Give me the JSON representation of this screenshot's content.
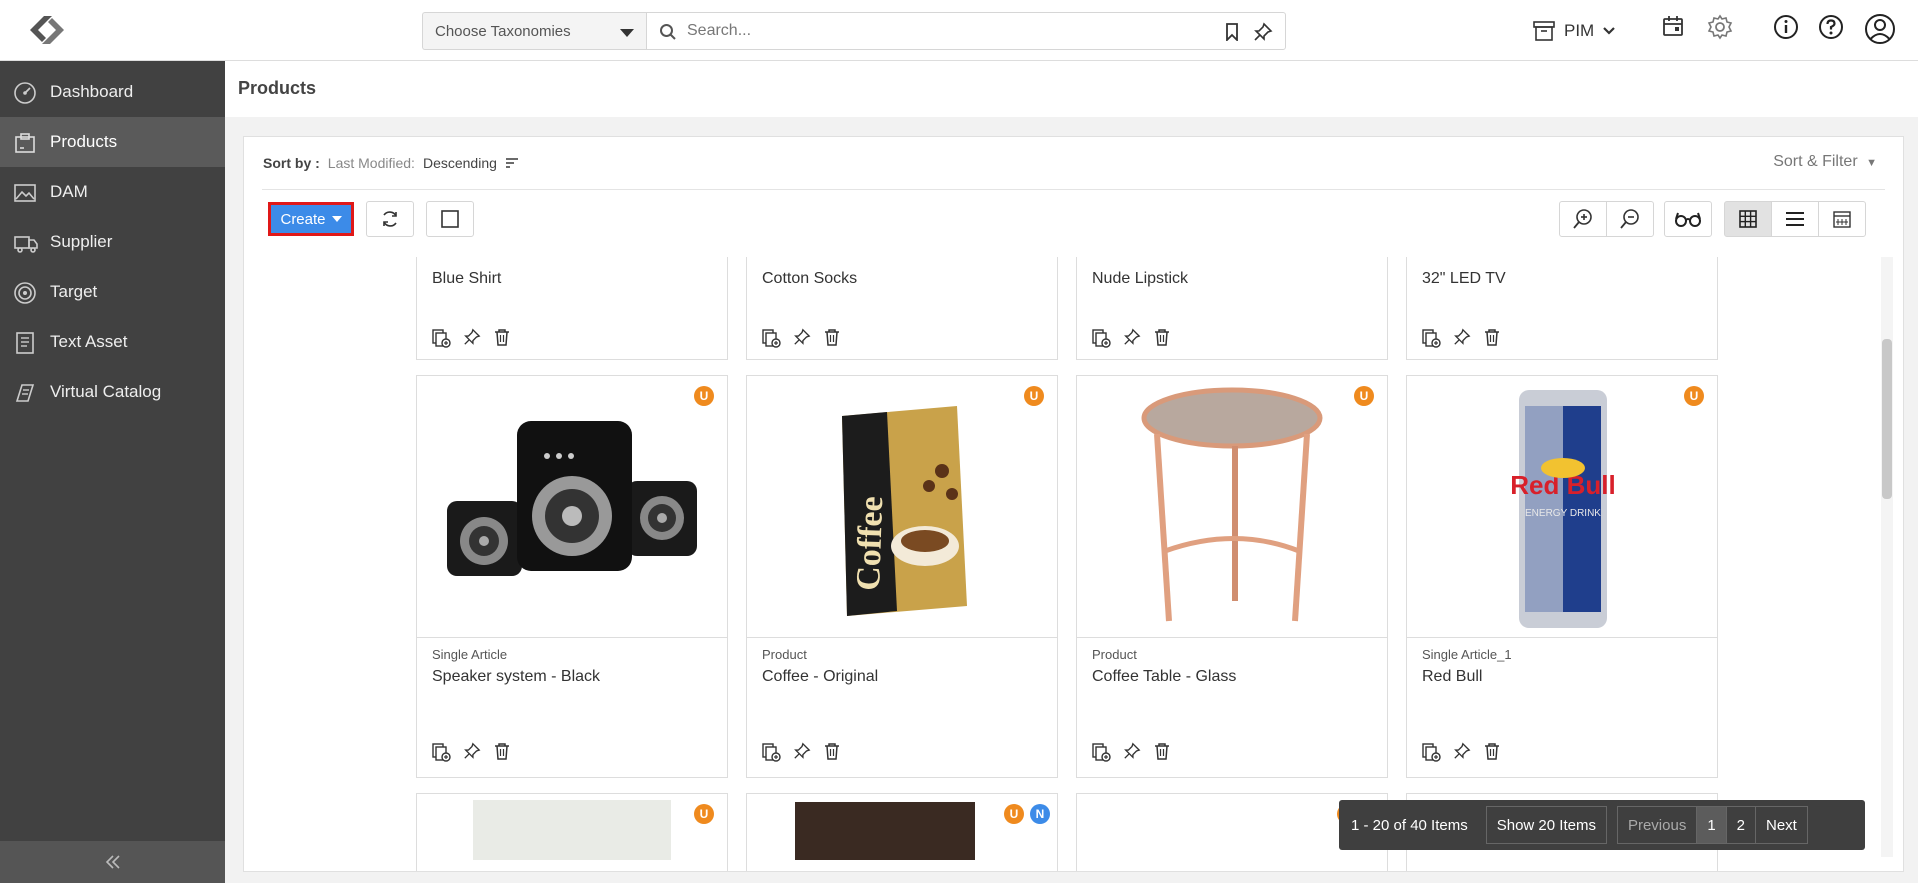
{
  "topbar": {
    "taxonomy_label": "Choose Taxonomies",
    "search_placeholder": "Search...",
    "module_label": "PIM"
  },
  "sidebar": {
    "items": [
      {
        "label": "Dashboard",
        "icon": "gauge-icon"
      },
      {
        "label": "Products",
        "icon": "box-icon",
        "active": true
      },
      {
        "label": "DAM",
        "icon": "image-icon"
      },
      {
        "label": "Supplier",
        "icon": "truck-icon"
      },
      {
        "label": "Target",
        "icon": "target-icon"
      },
      {
        "label": "Text Asset",
        "icon": "document-icon"
      },
      {
        "label": "Virtual Catalog",
        "icon": "catalog-icon"
      }
    ]
  },
  "page": {
    "title": "Products"
  },
  "sort": {
    "label": "Sort by :",
    "field": "Last Modified:",
    "direction": "Descending",
    "filter_label": "Sort & Filter"
  },
  "toolbar": {
    "create_label": "Create"
  },
  "products": {
    "row1": [
      {
        "name": "Blue Shirt"
      },
      {
        "name": "Cotton Socks"
      },
      {
        "name": "Nude Lipstick"
      },
      {
        "name": "32\" LED TV"
      }
    ],
    "row2": [
      {
        "type": "Single Article",
        "name": "Speaker system - Black",
        "badge": "U"
      },
      {
        "type": "Product",
        "name": "Coffee - Original",
        "badge": "U",
        "image_text": "Coffee"
      },
      {
        "type": "Product",
        "name": "Coffee Table - Glass",
        "badge": "U"
      },
      {
        "type": "Single Article_1",
        "name": "Red Bull",
        "badge": "U",
        "image_text": "Red Bull",
        "image_subtext": "ENERGY DRINK"
      }
    ],
    "row3_badges": [
      "U",
      "U",
      "N",
      "U"
    ]
  },
  "pager": {
    "info": "1 - 20 of 40 Items",
    "show": "Show 20 Items",
    "previous": "Previous",
    "pages": [
      "1",
      "2"
    ],
    "next": "Next"
  },
  "colors": {
    "sidebar_bg": "#414141",
    "accent_blue": "#3c8be8",
    "badge_orange": "#ef8a1e",
    "highlight_red": "#e01818"
  }
}
